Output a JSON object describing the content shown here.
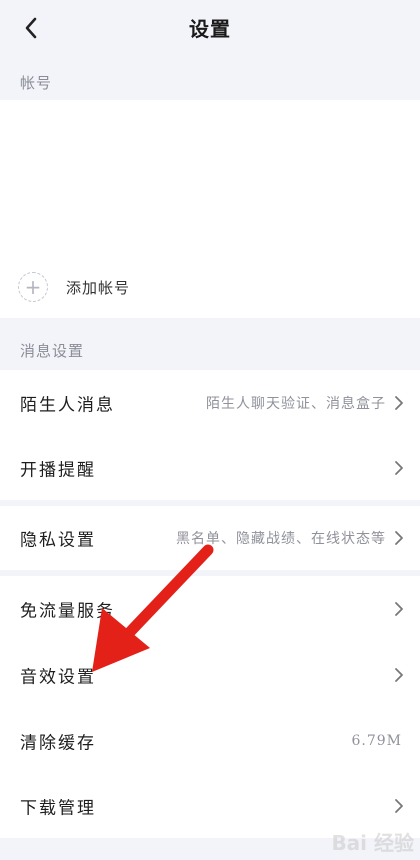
{
  "header": {
    "title": "设置"
  },
  "sections": {
    "account": "帐号",
    "messages": "消息设置"
  },
  "account": {
    "add_label": "添加帐号"
  },
  "rows": [
    {
      "label": "陌生人消息",
      "value": "陌生人聊天验证、消息盒子",
      "chevron": true
    },
    {
      "label": "开播提醒",
      "value": "",
      "chevron": true
    },
    {
      "label": "隐私设置",
      "value": "黑名单、隐藏战绩、在线状态等",
      "chevron": true
    },
    {
      "label": "免流量服务",
      "value": "",
      "chevron": true
    },
    {
      "label": "音效设置",
      "value": "",
      "chevron": true
    },
    {
      "label": "清除缓存",
      "value": "6.79M",
      "chevron": false
    },
    {
      "label": "下载管理",
      "value": "",
      "chevron": true
    }
  ],
  "annotation": {
    "color": "#e32119"
  },
  "watermark": "Bai 经验"
}
